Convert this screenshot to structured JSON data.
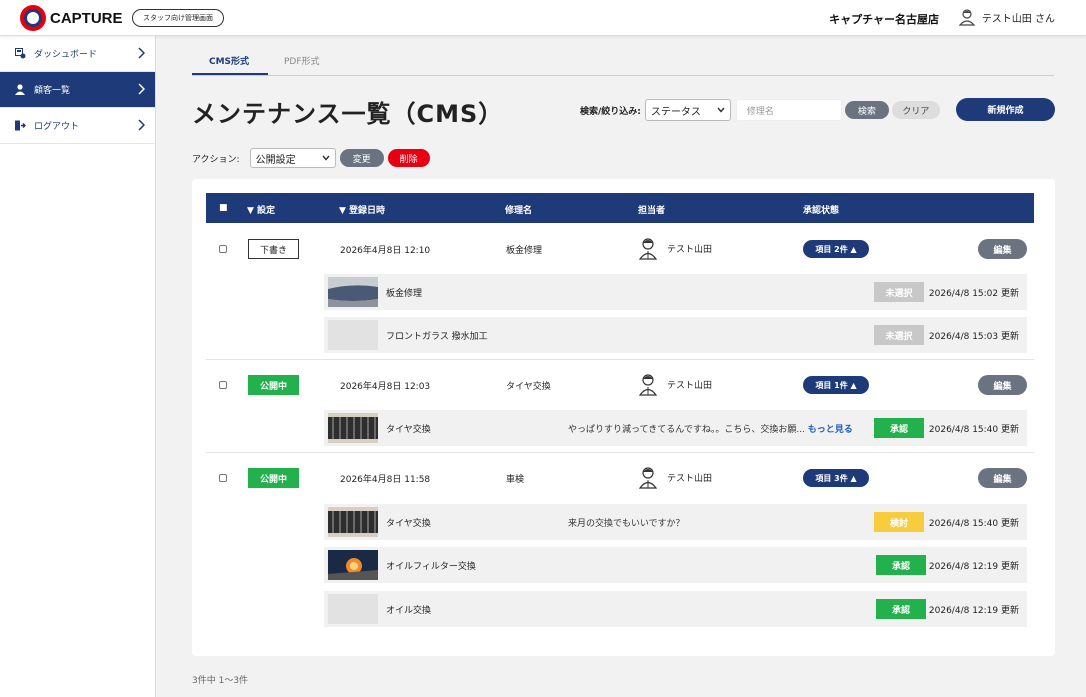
{
  "header": {
    "logo_text": "CAPTURE",
    "staff_badge": "スタッフ向け管理画面",
    "store_name": "キャプチャー名古屋店",
    "user_name": "テスト山田 さん"
  },
  "sidebar": {
    "items": [
      {
        "label": "ダッシュボード",
        "icon": "dashboard-icon"
      },
      {
        "label": "顧客一覧",
        "icon": "user-icon"
      },
      {
        "label": "ログアウト",
        "icon": "logout-icon"
      }
    ]
  },
  "tabs": [
    {
      "label": "CMS形式",
      "active": true
    },
    {
      "label": "PDF形式",
      "active": false
    }
  ],
  "page_title": "メンテナンス一覧（CMS）",
  "search": {
    "label": "検索/絞り込み:",
    "status_value": "ステータス",
    "repair_placeholder": "修理名",
    "search_label": "検索",
    "clear_label": "クリア"
  },
  "new_button": "新規作成",
  "actions": {
    "label": "アクション:",
    "select_value": "公開設定",
    "change_label": "変更",
    "delete_label": "削除"
  },
  "table": {
    "headers": {
      "select": "■",
      "setting": "▼ 設定",
      "registered": "▼ 登録日時",
      "repair": "修理名",
      "staff": "担当者",
      "approval": "承認状態"
    },
    "rows": [
      {
        "status": "下書き",
        "date": "2026年4月8日 12:10",
        "repair": "板金修理",
        "staff": "テスト山田",
        "items": "項目 2件 ▲",
        "edit": "編集",
        "subs": [
          {
            "title": "板金修理",
            "comment": "",
            "more": "",
            "badge": "未選択",
            "updated": "2026/4/8 15:02 更新"
          },
          {
            "title": "フロントガラス 撥水加工",
            "comment": "",
            "more": "",
            "badge": "未選択",
            "updated": "2026/4/8 15:03 更新"
          }
        ]
      },
      {
        "status": "公開中",
        "date": "2026年4月8日 12:03",
        "repair": "タイヤ交換",
        "staff": "テスト山田",
        "items": "項目 1件 ▲",
        "edit": "編集",
        "subs": [
          {
            "title": "タイヤ交換",
            "comment": "やっぱりすり減ってきてるんですね。。こちら、交換お願...",
            "more": "もっと見る",
            "badge": "承認",
            "updated": "2026/4/8 15:40 更新"
          }
        ]
      },
      {
        "status": "公開中",
        "date": "2026年4月8日 11:58",
        "repair": "車検",
        "staff": "テスト山田",
        "items": "項目 3件 ▲",
        "edit": "編集",
        "subs": [
          {
            "title": "タイヤ交換",
            "comment": "来月の交換でもいいですか？",
            "more": "",
            "badge": "検討",
            "updated": "2026/4/8 15:40 更新"
          },
          {
            "title": "オイルフィルター交換",
            "comment": "",
            "more": "",
            "badge": "承認",
            "updated": "2026/4/8 12:19 更新"
          },
          {
            "title": "オイル交換",
            "comment": "",
            "more": "",
            "badge": "承認",
            "updated": "2026/4/8 12:19 更新"
          }
        ]
      }
    ]
  },
  "pager": "3件中 1〜3件",
  "colors": {
    "primary": "#1e3a78",
    "danger": "#e60012",
    "success": "#22b14c",
    "warning": "#f9cc3e",
    "neutral": "#6b7280"
  }
}
